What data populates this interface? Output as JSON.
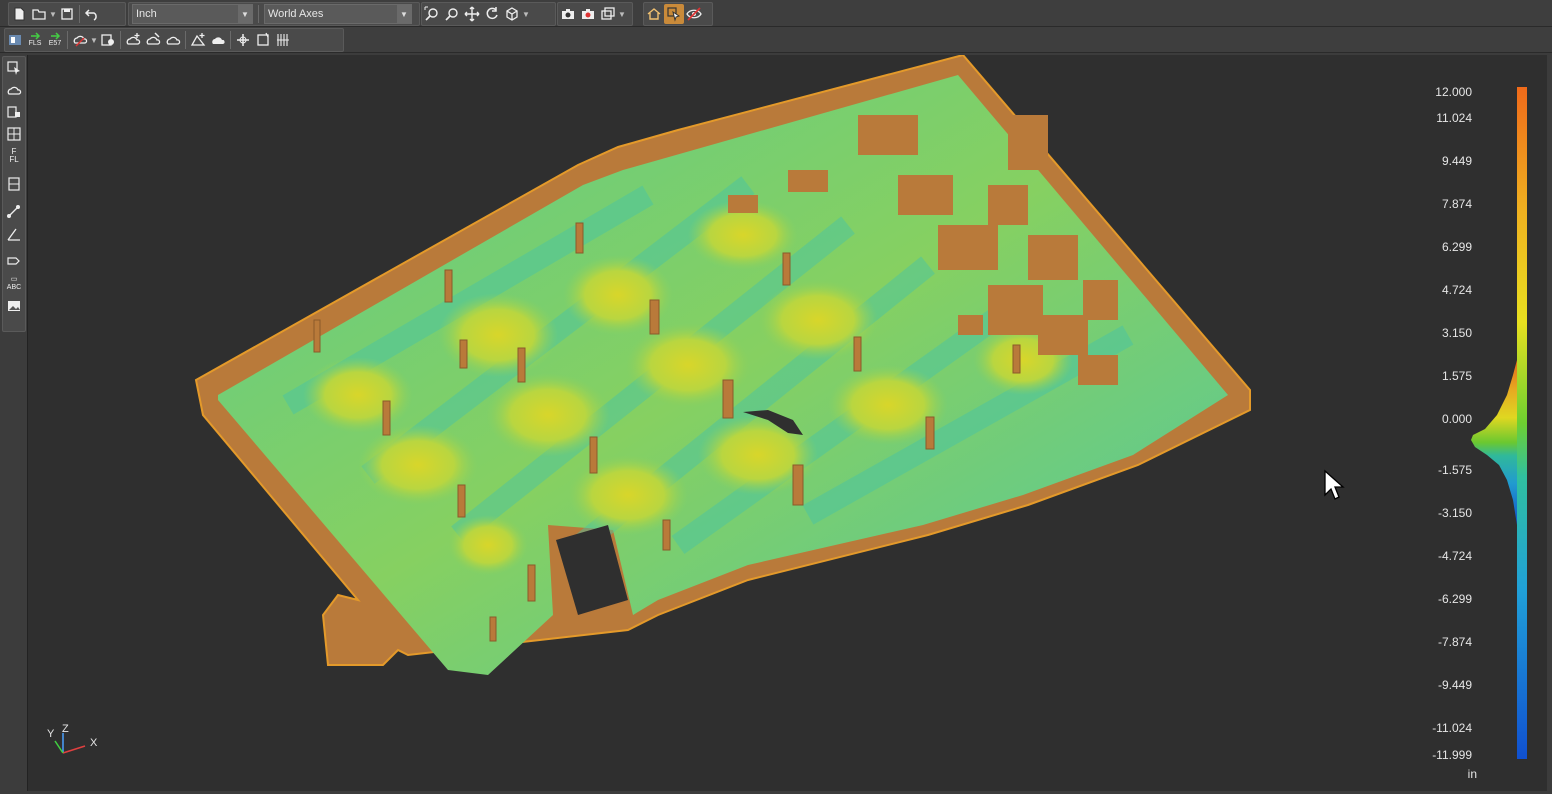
{
  "toolbar": {
    "units_value": "Inch",
    "axes_value": "World Axes"
  },
  "toolbar_row2": {
    "fls_label": "FLS",
    "e57_label": "E57"
  },
  "left_toolbar": {
    "floor_label": "FL",
    "text_label": "ABC"
  },
  "scale": {
    "ticks": [
      "12.000",
      "11.024",
      "9.449",
      "7.874",
      "6.299",
      "4.724",
      "3.150",
      "1.575",
      "0.000",
      "-1.575",
      "-3.150",
      "-4.724",
      "-6.299",
      "-7.874",
      "-9.449",
      "-11.024",
      "-11.999"
    ],
    "unit": "in"
  },
  "axes": {
    "y": "Y",
    "z": "Z",
    "x": "X"
  },
  "colors": {
    "wall": "#b97a3a",
    "floor_low": "#45c3a8",
    "floor_mid": "#8fd15b",
    "floor_high": "#d7d62a",
    "accent": "#c98a3a"
  }
}
